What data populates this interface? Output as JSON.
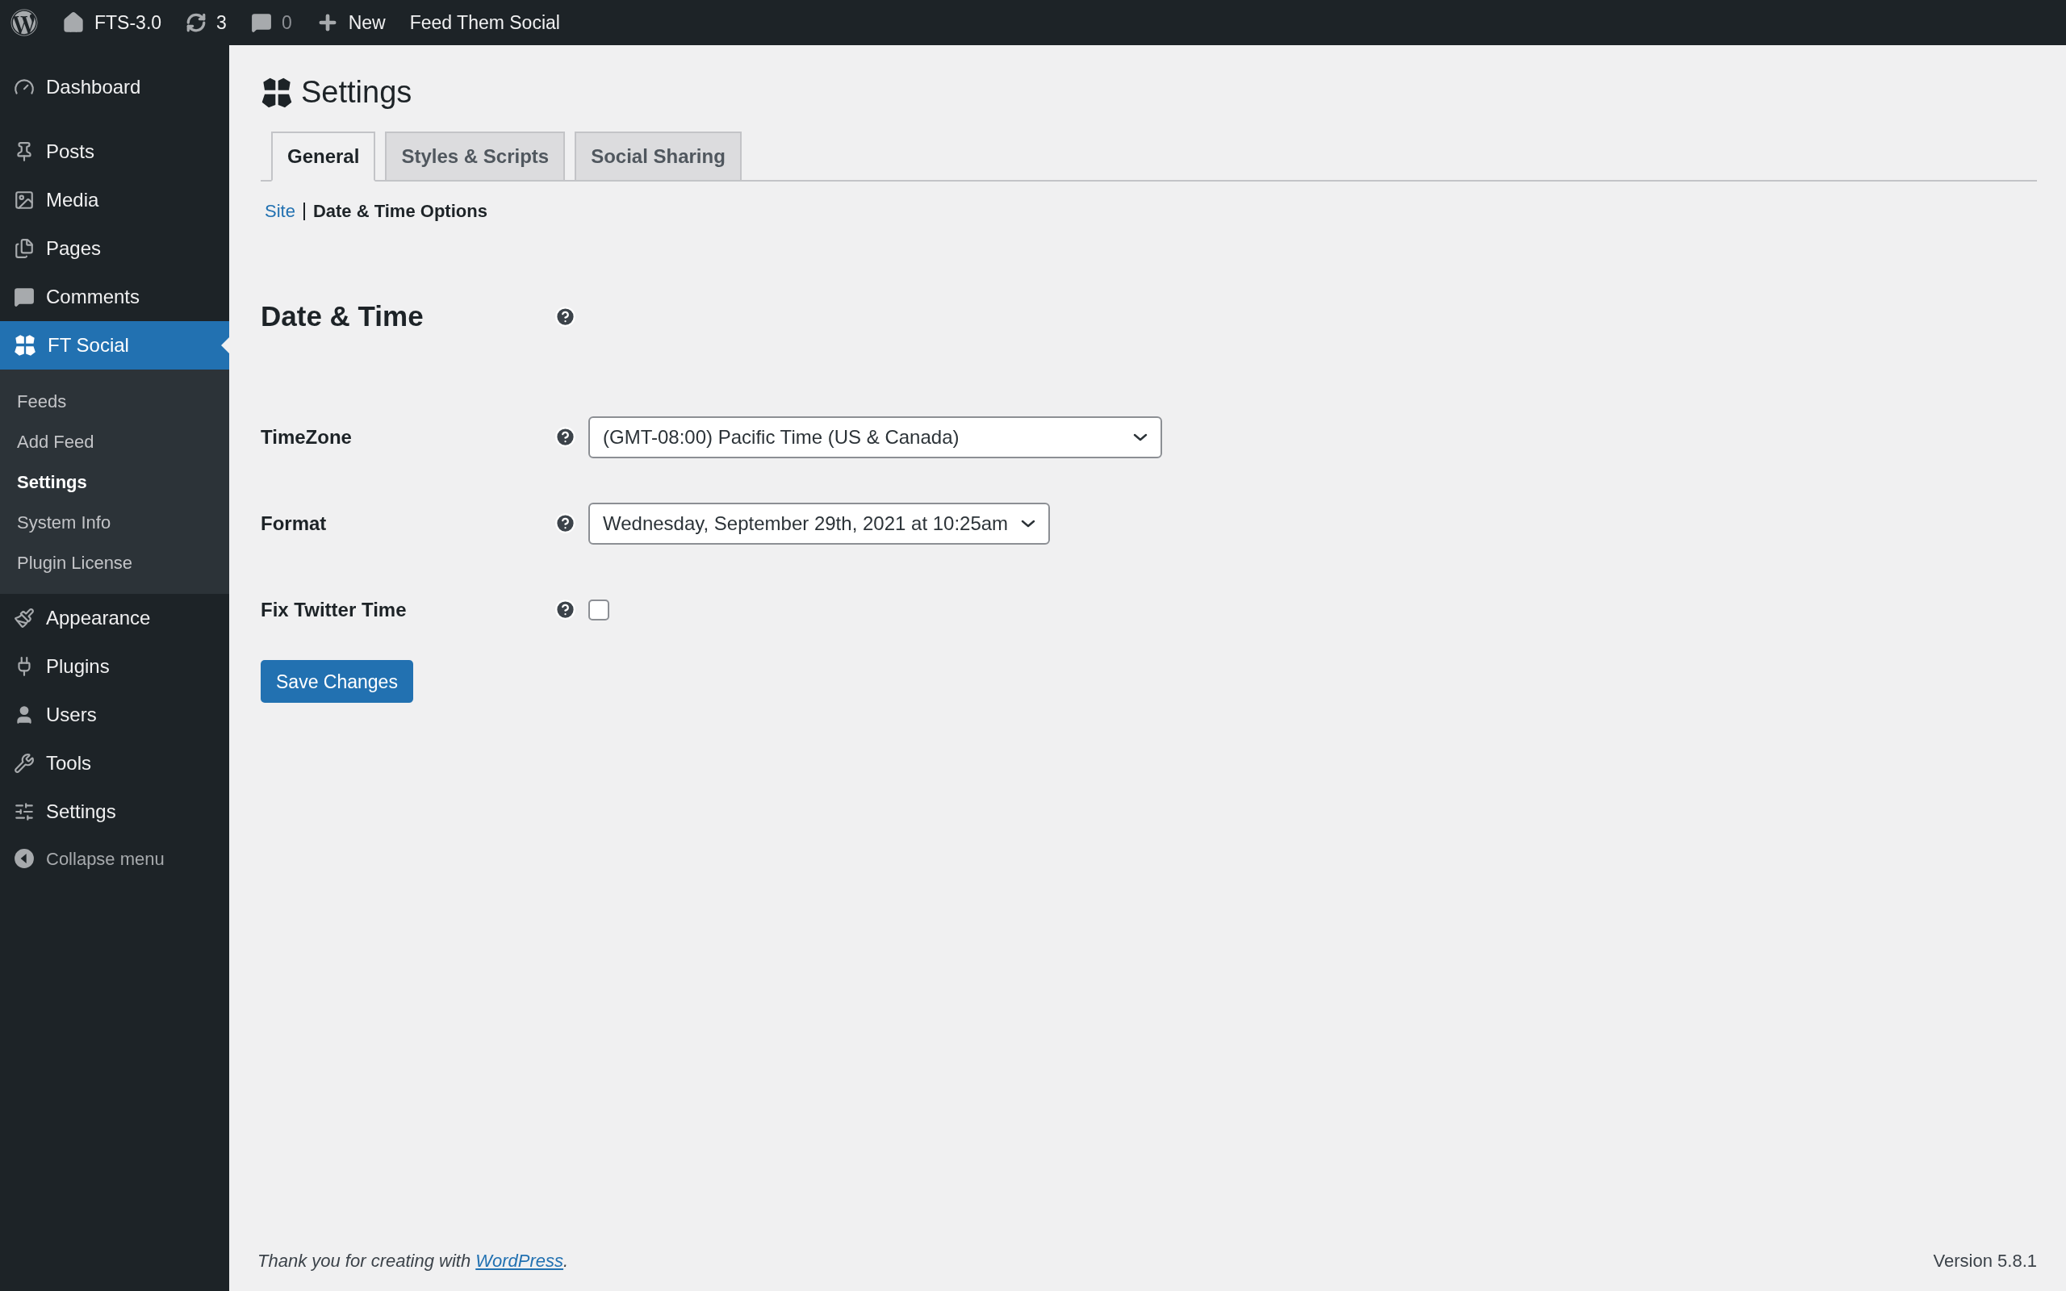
{
  "admin_bar": [
    {
      "kind": "logo"
    },
    {
      "kind": "site",
      "label": "FTS-3.0"
    },
    {
      "kind": "updates",
      "label": "3"
    },
    {
      "kind": "comments",
      "label": "0"
    },
    {
      "kind": "new",
      "label": "New"
    },
    {
      "kind": "plugin",
      "label": "Feed Them Social"
    }
  ],
  "sidebar": {
    "groups": [
      [
        {
          "kind": "dashboard",
          "label": "Dashboard",
          "selected": false
        }
      ],
      [
        {
          "kind": "posts",
          "label": "Posts",
          "selected": false
        },
        {
          "kind": "media",
          "label": "Media",
          "selected": false
        },
        {
          "kind": "pages",
          "label": "Pages",
          "selected": false
        },
        {
          "kind": "comments",
          "label": "Comments",
          "selected": false
        },
        {
          "kind": "ftsocial",
          "label": "FT Social",
          "selected": true,
          "children": [
            {
              "label": "Feeds",
              "selected": false
            },
            {
              "label": "Add Feed",
              "selected": false
            },
            {
              "label": "Settings",
              "selected": true
            },
            {
              "label": "System Info",
              "selected": false
            },
            {
              "label": "Plugin License",
              "selected": false
            }
          ]
        },
        {
          "kind": "appearance",
          "label": "Appearance",
          "selected": false
        },
        {
          "kind": "plugins",
          "label": "Plugins",
          "selected": false
        },
        {
          "kind": "users",
          "label": "Users",
          "selected": false
        },
        {
          "kind": "tools",
          "label": "Tools",
          "selected": false
        },
        {
          "kind": "settings",
          "label": "Settings",
          "selected": false
        }
      ]
    ],
    "collapse_menu": {
      "label": "Collapse menu"
    }
  },
  "page": {
    "title": "Settings",
    "tabs": [
      {
        "label": "General",
        "selected": true
      },
      {
        "label": "Styles & Scripts",
        "selected": false
      },
      {
        "label": "Social Sharing",
        "selected": false
      }
    ],
    "subnav": [
      {
        "label": "Site",
        "selected": false
      },
      {
        "label": "Date & Time Options",
        "selected": true
      }
    ],
    "section_title": "Date & Time",
    "fields": [
      {
        "kind": "select",
        "label": "TimeZone",
        "value": "(GMT-08:00) Pacific Time (US & Canada)"
      },
      {
        "kind": "select",
        "label": "Format",
        "value": "Wednesday, September 29th, 2021 at 10:25am"
      },
      {
        "kind": "checkbox",
        "label": "Fix Twitter Time",
        "checked": false
      }
    ],
    "save_button": "Save Changes"
  },
  "footer": {
    "text": "Thank you for creating with ",
    "link": "WordPress",
    "after": ".",
    "version": "Version 5.8.1"
  }
}
